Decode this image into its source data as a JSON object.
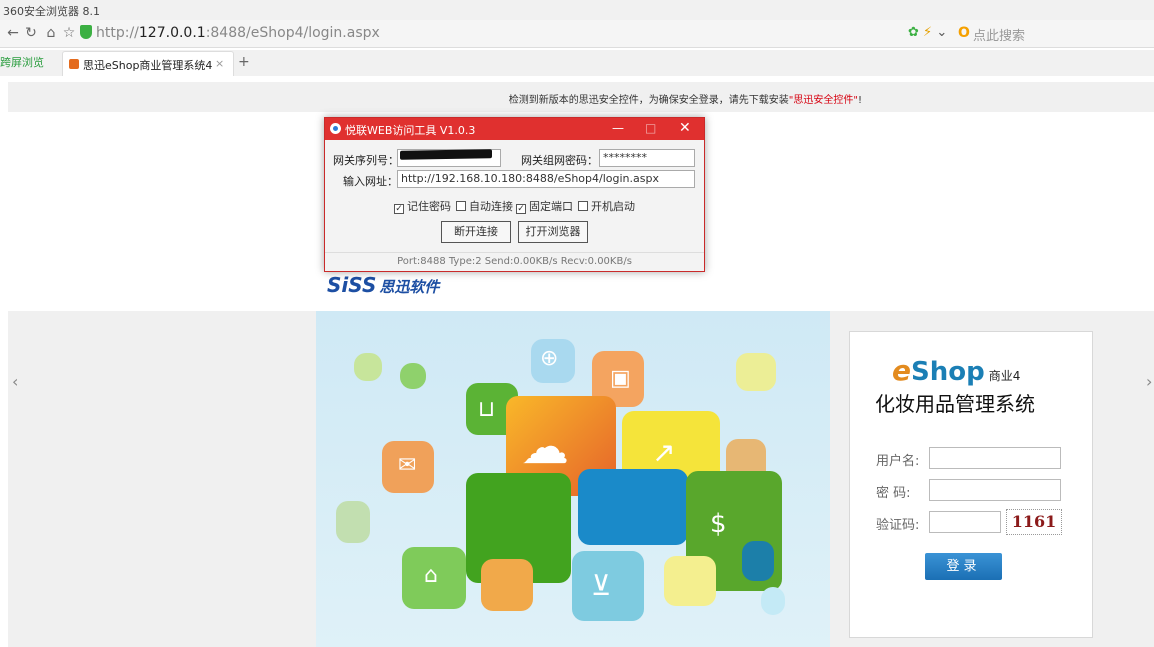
{
  "browser": {
    "app_title": "360安全浏览器 8.1",
    "url_scheme": "http://",
    "url_host": "127.0.0.1",
    "url_rest": ":8488/eShop4/login.aspx",
    "search_placeholder": "点此搜索",
    "tab_left": "跨屏浏览",
    "tab_active": "思迅eShop商业管理系统4",
    "tab_close": "×",
    "tab_plus": "+"
  },
  "notice": {
    "text": "检测到新版本的思迅安全控件，为确保安全登录，请先下载安装",
    "link": "\"思迅安全控件\"",
    "end": "!"
  },
  "tool": {
    "title": "悦联WEB访问工具 V1.0.3",
    "serial_label": "网关序列号：",
    "password_label": "网关组网密码：",
    "password_value": "********",
    "url_label": "输入网址：",
    "url_value": "http://192.168.10.180:8488/eShop4/login.aspx",
    "options": [
      {
        "label": "记住密码",
        "checked": true
      },
      {
        "label": "自动连接",
        "checked": false
      },
      {
        "label": "固定端口",
        "checked": true
      },
      {
        "label": "开机启动",
        "checked": false
      }
    ],
    "btn_disconnect": "断开连接",
    "btn_browser": "打开浏览器",
    "status": "Port:8488 Type:2 Send:0.00KB/s Recv:0.00KB/s"
  },
  "siss": {
    "brand": "SiSS",
    "cn": "思迅软件"
  },
  "login": {
    "brand_e": "e",
    "brand_shop": "Shop",
    "brand_version": "商业4",
    "system_name": "化妆用品管理系统",
    "username_label": "用户名:",
    "password_label": "密  码:",
    "captcha_label": "验证码:",
    "captcha_code": "1161",
    "login_button": "登录"
  },
  "carousel": {
    "prev": "‹",
    "next": "›"
  },
  "colors": {
    "accent_red": "#e0302f",
    "brand_blue": "#1d4fa3",
    "login_blue": "#1b6fb4"
  }
}
